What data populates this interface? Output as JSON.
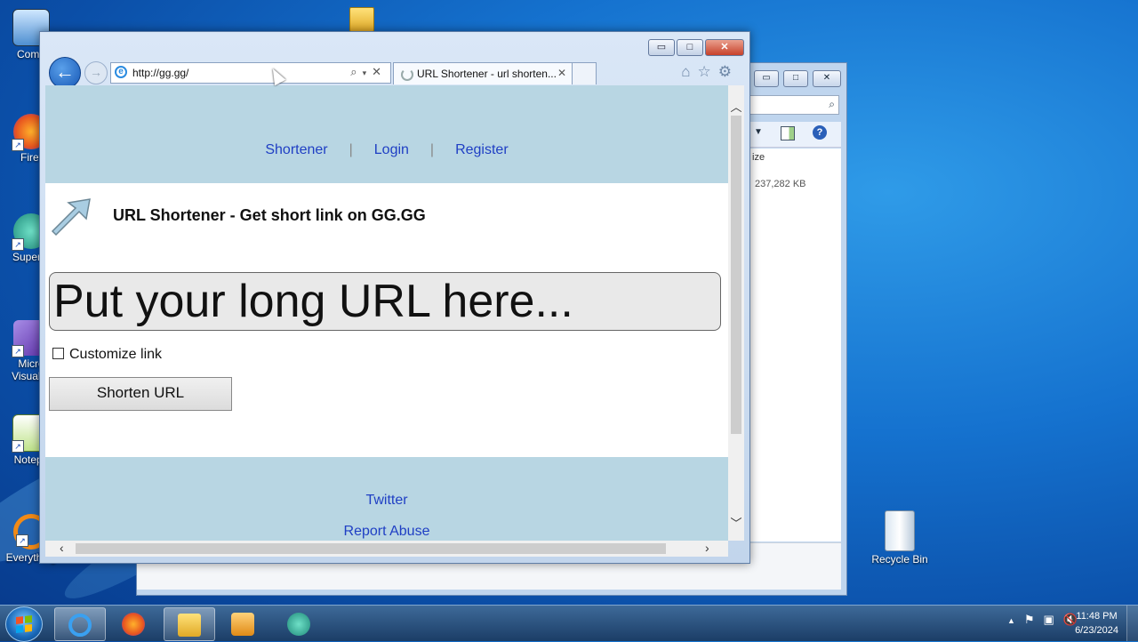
{
  "desktop": {
    "icons": [
      {
        "label": "Comp"
      },
      {
        "label": "Firef"
      },
      {
        "label": "Superm"
      },
      {
        "label": "Micro\nVisual S"
      },
      {
        "label": "Notepa"
      },
      {
        "label": "Everything"
      },
      {
        "label": "Recycle Bin"
      }
    ]
  },
  "explorer": {
    "column_header": "ize",
    "size_value": "237,282 KB"
  },
  "ie": {
    "address": "http://gg.gg/",
    "tab_title": "URL Shortener - url shorten...",
    "caption": {
      "minimize": "▭",
      "maximize": "□",
      "close": "✕"
    }
  },
  "page": {
    "menu": {
      "shortener": "Shortener",
      "login": "Login",
      "register": "Register",
      "separator": "|"
    },
    "headline": "URL Shortener - Get short link on GG.GG",
    "url_placeholder": "Put your long URL here...",
    "customize_label": "Customize link",
    "shorten_button": "Shorten URL",
    "footer": {
      "twitter": "Twitter",
      "report_abuse": "Report Abuse"
    }
  },
  "taskbar": {
    "time": "11:48 PM",
    "date": "6/23/2024"
  },
  "colors": {
    "link": "#1f3fc4",
    "header_bg": "#b8d6e3",
    "desktop": "#1572cf"
  }
}
